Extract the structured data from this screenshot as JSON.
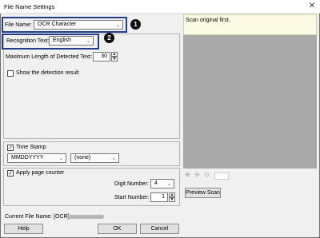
{
  "window": {
    "title": "File Name Settings"
  },
  "filename": {
    "label": "File Name:",
    "value": "OCR Character"
  },
  "recognition": {
    "label": "Recognition Text:",
    "value": "English"
  },
  "maxlen": {
    "label": "Maximum Length of Detected Text:",
    "value": "30"
  },
  "show_detection": {
    "label": "Show the detection result",
    "checked": false
  },
  "timestamp": {
    "label": "Time Stamp",
    "checked": true,
    "format": "MMDDYYYY",
    "separator": "(none)"
  },
  "page_counter": {
    "label": "Apply page counter",
    "checked": true,
    "digit_label": "Digit Number:",
    "digit_value": "4",
    "start_label": "Start Number:",
    "start_value": "1"
  },
  "preview": {
    "message": "Scan original first.",
    "scan_button": "Preview Scan"
  },
  "current": {
    "label": "Current File Name: [OCR]"
  },
  "buttons": {
    "help": "Help",
    "ok": "OK",
    "cancel": "Cancel"
  },
  "callouts": [
    "1",
    "2"
  ],
  "icons": {
    "close": "close-icon",
    "zoom_in": "zoom-in-icon",
    "zoom_out": "zoom-out-icon",
    "fit": "fit-icon",
    "dropdown": "chevron-down-icon"
  },
  "colors": {
    "callout_border": "#1f3f8a",
    "preview_bg": "#a9a9a9",
    "message_bg": "#fbfbe3"
  }
}
